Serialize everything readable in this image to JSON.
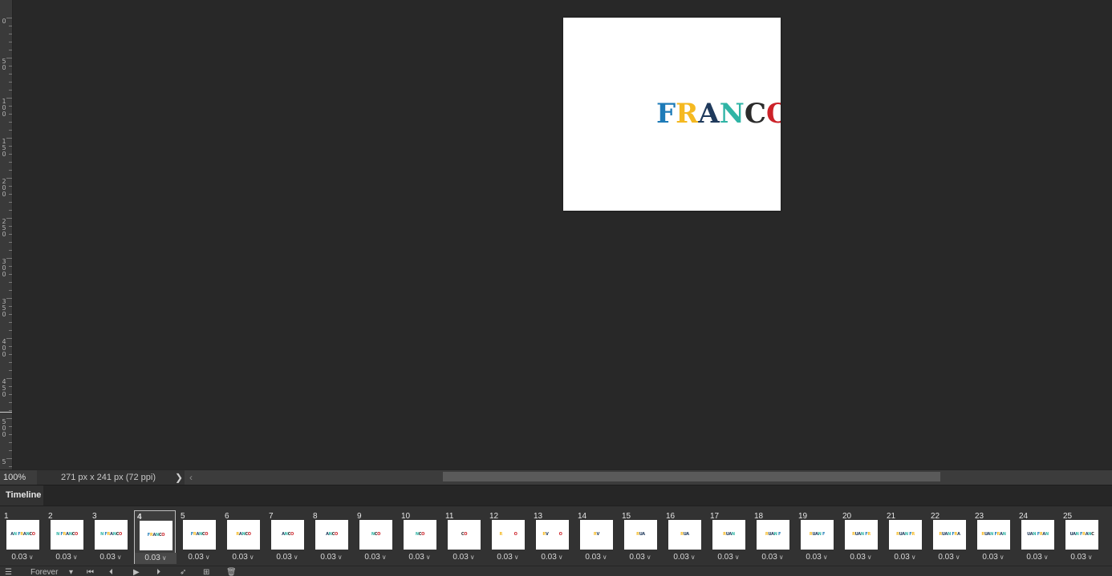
{
  "document": {
    "word_letters": [
      {
        "char": "F",
        "color": "#1e7bb8"
      },
      {
        "char": "R",
        "color": "#f5b921"
      },
      {
        "char": "A",
        "color": "#1f3a5c"
      },
      {
        "char": "N",
        "color": "#2fb4a5"
      },
      {
        "char": "C",
        "color": "#2b2b2b"
      },
      {
        "char": "O",
        "color": "#cc2229"
      }
    ]
  },
  "ruler": {
    "labels": [
      {
        "text": "0"
      },
      {
        "text": "5\n0"
      },
      {
        "text": "1\n0\n0"
      },
      {
        "text": "1\n5\n0"
      },
      {
        "text": "2\n0\n0"
      },
      {
        "text": "2\n5\n0"
      },
      {
        "text": "3\n0\n0"
      },
      {
        "text": "3\n5\n0"
      },
      {
        "text": "4\n0\n0"
      },
      {
        "text": "4\n5\n0"
      },
      {
        "text": "5\n0\n0"
      },
      {
        "text": "5"
      }
    ]
  },
  "status": {
    "zoom": "100%",
    "doc_info": "271 px x 241 px (72 ppi)",
    "info_arrow": "❯",
    "scroll_left": "‹"
  },
  "timeline": {
    "tab_label": "Timeline",
    "selected_frame": 4,
    "frames": [
      {
        "num": "1",
        "time": "0.03",
        "thumb": "AN FRANCO"
      },
      {
        "num": "2",
        "time": "0.03",
        "thumb": "N FRANCO"
      },
      {
        "num": "3",
        "time": "0.03",
        "thumb": "N FRANCO"
      },
      {
        "num": "4",
        "time": "0.03",
        "thumb": "FRANCO"
      },
      {
        "num": "5",
        "time": "0.03",
        "thumb": "FRANCO"
      },
      {
        "num": "6",
        "time": "0.03",
        "thumb": "RANCO"
      },
      {
        "num": "7",
        "time": "0.03",
        "thumb": "ANCO"
      },
      {
        "num": "8",
        "time": "0.03",
        "thumb": "ANCO"
      },
      {
        "num": "9",
        "time": "0.03",
        "thumb": "NCO"
      },
      {
        "num": "10",
        "time": "0.03",
        "thumb": "NCO"
      },
      {
        "num": "11",
        "time": "0.03",
        "thumb": "CO"
      },
      {
        "num": "12",
        "time": "0.03",
        "thumb": "R          O"
      },
      {
        "num": "13",
        "time": "0.03",
        "thumb": "RV         O"
      },
      {
        "num": "14",
        "time": "0.03",
        "thumb": "RV"
      },
      {
        "num": "15",
        "time": "0.03",
        "thumb": "RUA"
      },
      {
        "num": "16",
        "time": "0.03",
        "thumb": "RUA"
      },
      {
        "num": "17",
        "time": "0.03",
        "thumb": "RUAN"
      },
      {
        "num": "18",
        "time": "0.03",
        "thumb": "RUAN F"
      },
      {
        "num": "19",
        "time": "0.03",
        "thumb": "RUAN F"
      },
      {
        "num": "20",
        "time": "0.03",
        "thumb": "RUAN FR"
      },
      {
        "num": "21",
        "time": "0.03",
        "thumb": "RUAN FR"
      },
      {
        "num": "22",
        "time": "0.03",
        "thumb": "RUAN FRA"
      },
      {
        "num": "23",
        "time": "0.03",
        "thumb": "RUAN FRAN"
      },
      {
        "num": "24",
        "time": "0.03",
        "thumb": "UAN FRAN"
      },
      {
        "num": "25",
        "time": "0.03",
        "thumb": "UAN FRANC"
      }
    ],
    "controls": {
      "loop_value": "Forever",
      "loop_chevron": "▾",
      "first_frame_icon": "⏮",
      "prev_frame_icon": "⏴",
      "play_icon": "▶",
      "next_frame_icon": "⏵",
      "tween_icon": "➶",
      "duplicate_icon": "⊞",
      "delete_icon": "🗑"
    }
  }
}
